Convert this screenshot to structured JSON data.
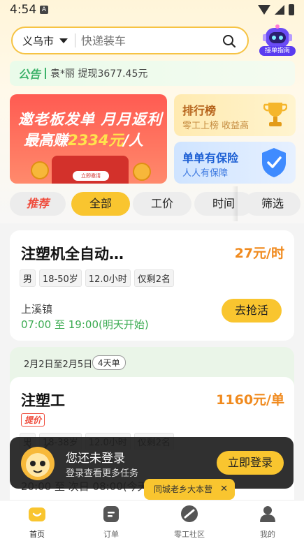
{
  "status_bar": {
    "time": "4:54",
    "notification_icon": "A"
  },
  "search": {
    "city": "义乌市",
    "placeholder": "快递装车"
  },
  "assistant": {
    "label": "接单指南"
  },
  "notice": {
    "tag": "公告",
    "text": "袁*丽 提现3677.45元"
  },
  "banner": {
    "line1": "邀老板发单 月月返利",
    "line2_prefix": "最高赚",
    "line2_amount": "2334元",
    "line2_suffix": "/人",
    "button": "立即邀请"
  },
  "side_cards": [
    {
      "title": "排行榜",
      "subtitle": "零工上榜 收益高",
      "icon": "trophy-icon"
    },
    {
      "title": "单单有保险",
      "subtitle": "人人有保障",
      "icon": "shield-icon"
    }
  ],
  "filters": [
    "推荐",
    "全部",
    "工价",
    "时间",
    "筛选"
  ],
  "active_filter": "全部",
  "jobs": [
    {
      "title": "注塑机全自动…",
      "price": "27元/时",
      "tags": [
        "男",
        "18-50岁",
        "12.0小时",
        "仅剩2名"
      ],
      "location": "上溪镇",
      "time": "07:00 至 19:00(明天开始)",
      "button": "去抢活"
    },
    {
      "group_range": "2月2日至2月5日",
      "group_days": "4天单",
      "title": "注塑工",
      "price": "1160元/单",
      "badge": "提价",
      "tags": [
        "男",
        "18-38岁",
        "12.0小时",
        "仅剩2名"
      ],
      "time": "20:00 至 次日 08:00(今天"
    }
  ],
  "login_toast": {
    "title": "您还未登录",
    "subtitle": "登录查看更多任务",
    "button": "立即登录"
  },
  "community_tip": {
    "text": "同城老乡大本营",
    "close": "✕"
  },
  "tabbar": [
    {
      "label": "首页",
      "icon": "home-icon",
      "active": true
    },
    {
      "label": "订单",
      "icon": "order-icon",
      "active": false
    },
    {
      "label": "零工社区",
      "icon": "community-icon",
      "active": false
    },
    {
      "label": "我的",
      "icon": "profile-icon",
      "active": false
    }
  ],
  "colors": {
    "accent": "#f9c52f",
    "price": "#f08a1e",
    "green": "#3cab52",
    "red": "#ef4b3b"
  }
}
